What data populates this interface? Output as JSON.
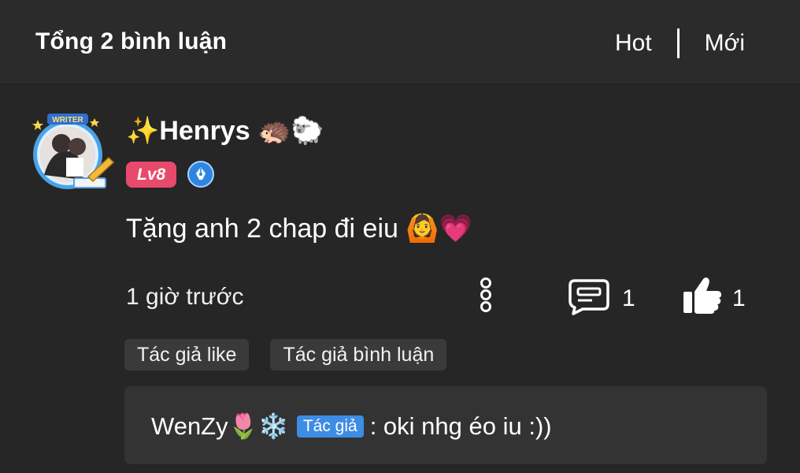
{
  "header": {
    "title": "Tổng 2 bình luận",
    "sort_hot": "Hot",
    "sort_new": "Mới"
  },
  "comment": {
    "avatar_badge_text": "WRITER",
    "username": "✨Henrys 🦔🐑",
    "level": "Lv8",
    "content": "Tặng anh 2 chap đi eiu 🙆💗",
    "time": "1 giờ trước",
    "reply_count": "1",
    "like_count": "1",
    "tags": [
      "Tác giả like",
      "Tác giả bình luận"
    ],
    "icons": {
      "more": "more-vertical-icon",
      "reply": "comment-icon",
      "like": "thumbs-up-icon",
      "pen": "pen-nib-icon"
    }
  },
  "reply": {
    "author": "WenZy🌷❄️",
    "author_tag": "Tác giả",
    "text": ": oki nhg éo iu :))"
  },
  "colors": {
    "background": "#262626",
    "header": "#2b2b2b",
    "level_badge": "#e84a6c",
    "author_tag": "#3d8ce5"
  }
}
